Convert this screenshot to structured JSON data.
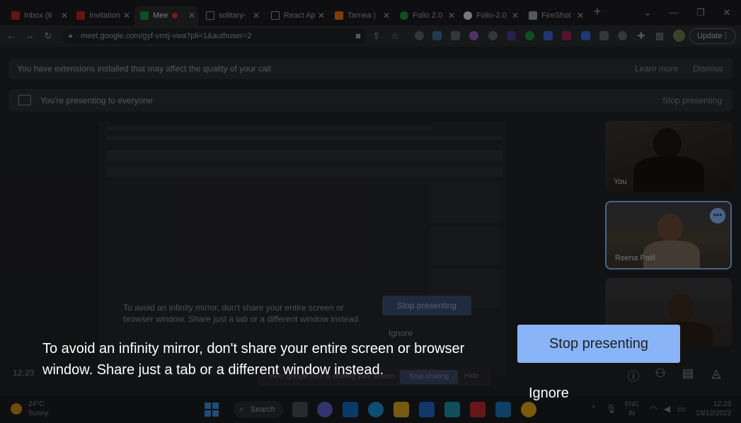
{
  "browser": {
    "tabs": [
      {
        "label": "Inbox (6",
        "color": "#c5221f"
      },
      {
        "label": "Invitation",
        "color": "#c5221f"
      },
      {
        "label": "Mee",
        "color": "#1e8e3e"
      },
      {
        "label": "solitary-",
        "color": "#9aa0a6"
      },
      {
        "label": "React Ap",
        "color": "#9aa0a6"
      },
      {
        "label": "Tarnea |",
        "color": "#e37400"
      },
      {
        "label": "Folio 2.0",
        "color": "#1e8e3e"
      },
      {
        "label": "Folio-2.0",
        "color": "#dadce0"
      },
      {
        "label": "FireShot",
        "color": "#9aa0a6"
      }
    ],
    "url": "meet.google.com/gyf-vmtj-vwa?pli=1&authuser=2",
    "update_label": "Update"
  },
  "meet": {
    "extension_banner": "You have extensions installed that may affect the quality of your call",
    "learn_more": "Learn more",
    "dismiss": "Dismiss",
    "presenting_banner": "You're presenting to everyone",
    "stop_presenting_link": "Stop presenting",
    "participants": [
      {
        "name": "You"
      },
      {
        "name": "Reena Patil"
      },
      {
        "name": ""
      }
    ],
    "clock": "12:23",
    "sharing_text": "meet.google.com is sharing your screen.",
    "mini_stop": "Stop sharing",
    "mini_hide": "Hide"
  },
  "dialog": {
    "warning": "To avoid an infinity mirror, don't share your entire screen or browser window. Share just a tab or a different window instead.",
    "stop_presenting": "Stop presenting",
    "ignore": "Ignore"
  },
  "taskbar": {
    "temperature": "24°C",
    "condition": "Sunny",
    "search": "Search",
    "lang_line1": "ENG",
    "lang_line2": "IN",
    "time": "12:23",
    "date": "19/12/2022"
  }
}
